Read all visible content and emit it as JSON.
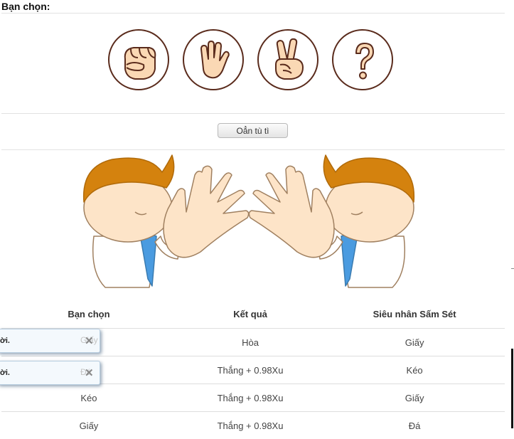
{
  "header": {
    "title": "Bạn chọn:"
  },
  "choices": [
    {
      "name": "rock",
      "icon": "fist-hand-icon"
    },
    {
      "name": "paper",
      "icon": "open-hand-icon"
    },
    {
      "name": "scissors",
      "icon": "victory-hand-icon"
    },
    {
      "name": "random",
      "icon": "question-mark-icon"
    }
  ],
  "play_button": {
    "label": "Oẳn tù tì"
  },
  "results_table": {
    "headers": {
      "user": "Bạn chọn",
      "result": "Kết quả",
      "bot": "Siêu nhân Sấm Sét"
    },
    "rows": [
      {
        "user": "Giấy",
        "result": "Hòa",
        "bot": "Giấy"
      },
      {
        "user": "Đá",
        "result": "Thắng + 0.98Xu",
        "bot": "Kéo"
      },
      {
        "user": "Kéo",
        "result": "Thắng + 0.98Xu",
        "bot": "Giấy"
      },
      {
        "user": "Giấy",
        "result": "Thắng + 0.98Xu",
        "bot": "Đá"
      }
    ]
  },
  "toasts": [
    {
      "message": "ời.",
      "close": "✕"
    },
    {
      "message": "ời.",
      "close": "✕"
    }
  ],
  "colors": {
    "accent_border": "#5a2b1c",
    "hair": "#d4820e",
    "skin": "#fde4c8",
    "tie": "#4a9be0"
  }
}
